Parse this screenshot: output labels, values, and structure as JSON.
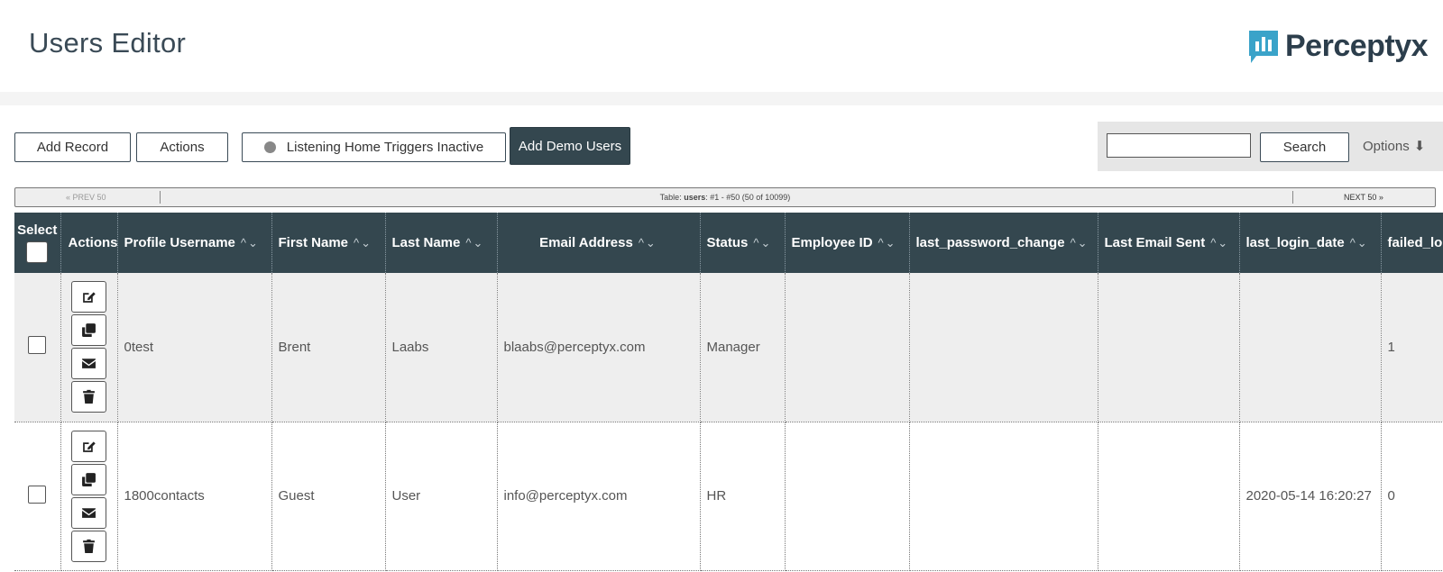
{
  "header": {
    "title": "Users Editor",
    "logo_text": "Perceptyx"
  },
  "toolbar": {
    "add_record": "Add Record",
    "actions": "Actions",
    "listening": "Listening Home Triggers Inactive",
    "add_demo": "Add Demo Users"
  },
  "search": {
    "button": "Search",
    "options": "Options",
    "value": ""
  },
  "pager": {
    "prev": "« PREV 50",
    "info_prefix": "Table: ",
    "info_table": "users",
    "info_rest": ": #1 - #50 (50 of 10099)",
    "next": "NEXT 50 »"
  },
  "table": {
    "headers": [
      "Select",
      "Actions",
      "Profile Username",
      "First Name",
      "Last Name",
      "Email Address",
      "Status",
      "Employee ID",
      "last_password_change",
      "Last Email Sent",
      "last_login_date",
      "failed_lo"
    ],
    "rows": [
      {
        "username": "0test",
        "first": "Brent",
        "last": "Laabs",
        "email": "blaabs@perceptyx.com",
        "status": "Manager",
        "employee_id": "",
        "last_password_change": "",
        "last_email_sent": "",
        "last_login_date": "",
        "failed": "1"
      },
      {
        "username": "1800contacts",
        "first": "Guest",
        "last": "User",
        "email": "info@perceptyx.com",
        "status": "HR",
        "employee_id": "",
        "last_password_change": "",
        "last_email_sent": "",
        "last_login_date": "2020-05-14 16:20:27",
        "failed": "0"
      }
    ]
  },
  "icons": {
    "edit": "edit-icon",
    "copy": "copy-icon",
    "email": "envelope-icon",
    "delete": "trash-icon",
    "options": "arrow-down-icon"
  },
  "colors": {
    "header_bg": "#34474f",
    "brand": "#2c3e4c",
    "logo_accent": "#3aa3c9"
  }
}
